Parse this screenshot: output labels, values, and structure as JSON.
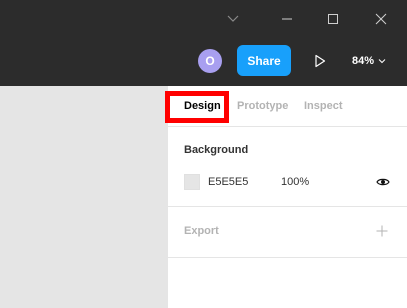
{
  "titlebar": {
    "buttons": [
      "chevron-down-icon",
      "minimize-icon",
      "maximize-icon",
      "close-icon"
    ]
  },
  "toolbar": {
    "avatar_initial": "O",
    "share_label": "Share",
    "play_icon": "play-icon",
    "zoom_label": "84%"
  },
  "panel": {
    "tabs": [
      {
        "label": "Design",
        "active": true
      },
      {
        "label": "Prototype",
        "active": false
      },
      {
        "label": "Inspect",
        "active": false
      }
    ],
    "background": {
      "title": "Background",
      "hex": "E5E5E5",
      "opacity": "100%",
      "swatch_color": "#E5E5E5"
    },
    "export": {
      "title": "Export"
    }
  },
  "colors": {
    "chrome": "#2C2C2C",
    "share_blue": "#18A0FB",
    "avatar_purple": "#A89FF0",
    "canvas": "#E5E5E5",
    "highlight_red": "#FF0000"
  }
}
